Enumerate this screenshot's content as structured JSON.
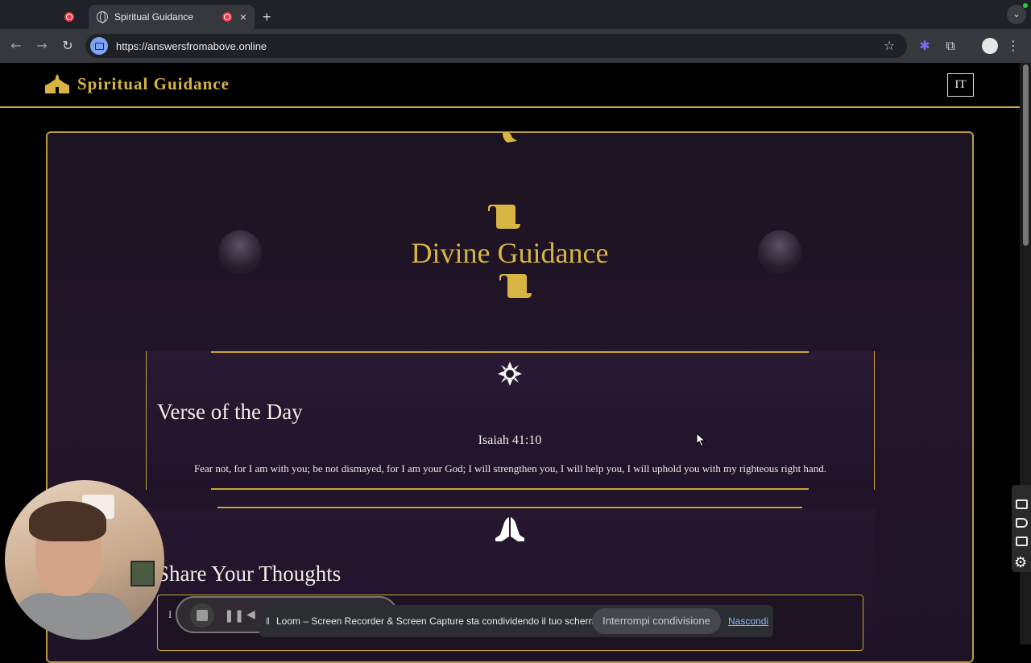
{
  "browser": {
    "tab_title": "Spiritual Guidance",
    "url": "https://answersfromabove.online",
    "new_tab_label": "+",
    "close_label": "×"
  },
  "site": {
    "brand": "Spiritual Guidance",
    "lang_button": "IT"
  },
  "main": {
    "title": "Divine Guidance"
  },
  "verse": {
    "heading": "Verse of the Day",
    "reference": "Isaiah 41:10",
    "text": "Fear not, for I am with you; be not dismayed, for I am your God; I will strengthen you, I will help you, I will uphold you with my righteous right hand."
  },
  "share": {
    "heading": "Share Your Thoughts",
    "partial_text": "I "
  },
  "screen_share_notice": {
    "message": "Loom – Screen Recorder & Screen Capture sta condividendo il tuo schermo.",
    "stop_button": "Interrompi condivisione",
    "hide_link": "Nascondi"
  },
  "colors": {
    "gold": "#d8b542",
    "panel_bg": "#1f1327",
    "link_blue": "#8ab4f8"
  }
}
